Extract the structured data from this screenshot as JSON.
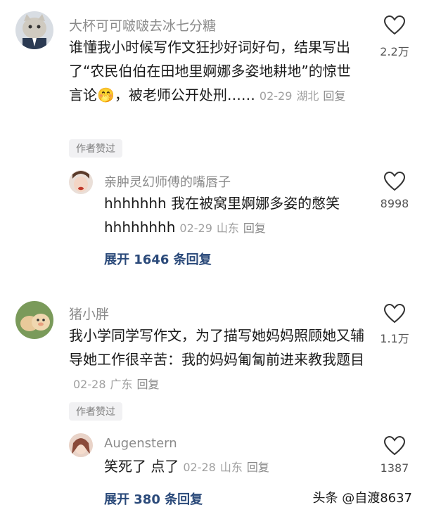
{
  "comments": [
    {
      "username": "大杯可可啵啵去冰七分糖",
      "text": "谁懂我小时候写作文狂抄好词好句，结果写出了“农民伯伯在田地里婀娜多姿地耕地”的惊世言论🤭，被老师公开处刑……",
      "date": "02-29",
      "location": "湖北",
      "reply_label": "回复",
      "likes": "2.2万",
      "badge": "作者赞过",
      "replies": [
        {
          "username": "亲肿灵幻师傅的嘴唇子",
          "text": "hhhhhhh 我在被窝里婀娜多姿的憋笑hhhhhhhh",
          "date": "02-29",
          "location": "山东",
          "reply_label": "回复",
          "likes": "8998"
        }
      ],
      "expand": {
        "prefix": "展开",
        "count": "1646",
        "suffix": "条回复"
      }
    },
    {
      "username": "猪小胖",
      "text": "我小学同学写作文，为了描写她妈妈照顾她又辅导她工作很辛苦：我的妈妈匍匐前进来教我题目",
      "date": "02-28",
      "location": "广东",
      "reply_label": "回复",
      "likes": "1.1万",
      "badge": "作者赞过",
      "replies": [
        {
          "username": "Augenstern",
          "text": "笑死了 点了",
          "date": "02-28",
          "location": "山东",
          "reply_label": "回复",
          "likes": "1387"
        }
      ],
      "expand": {
        "prefix": "展开",
        "count": "380",
        "suffix": "条回复"
      }
    }
  ],
  "watermark": "头条 @自渡8637",
  "colors": {
    "expand": "#2b4a7a",
    "meta": "#a0a0a0",
    "username": "#8a8a8a"
  }
}
